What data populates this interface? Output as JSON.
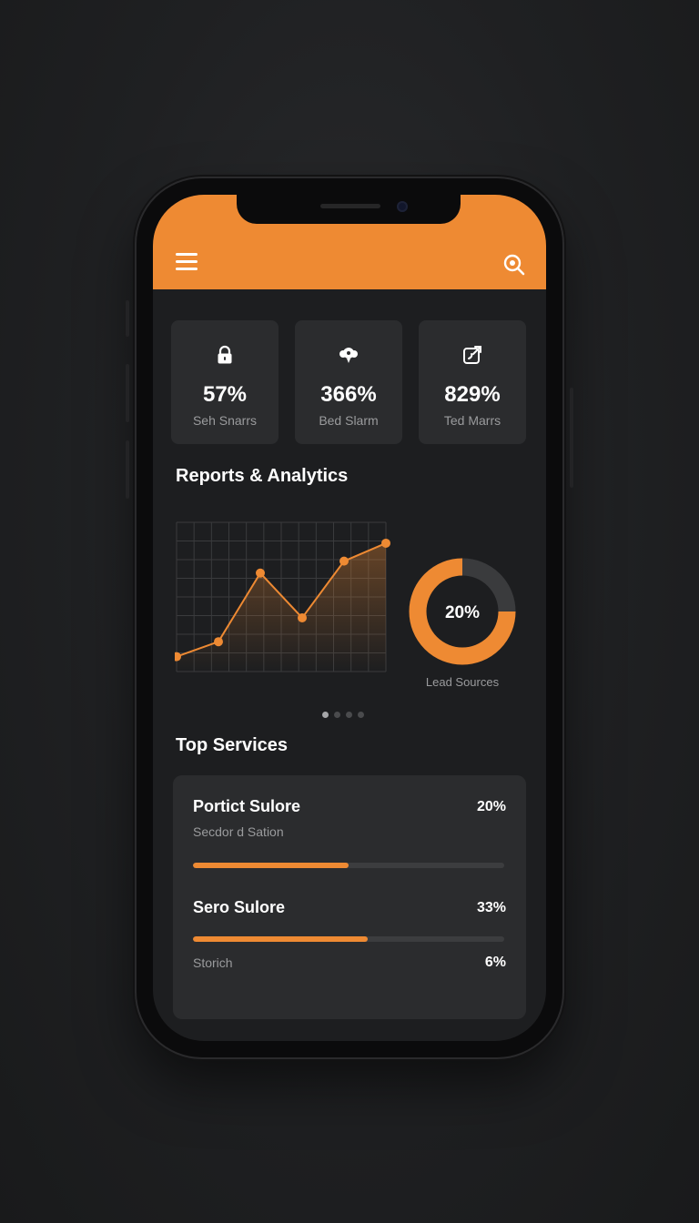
{
  "header": {
    "menu_icon": "menu-icon",
    "search_icon": "search-icon",
    "accent_color": "#ee8a33"
  },
  "stats": [
    {
      "icon": "lock-icon",
      "value": "57%",
      "label": "Seh Snarrs"
    },
    {
      "icon": "cloud-icon",
      "value": "366%",
      "label": "Bed Slarm"
    },
    {
      "icon": "edit-icon",
      "value": "829%",
      "label": "Ted Marrs"
    }
  ],
  "reports": {
    "title": "Reports & Analytics"
  },
  "chart_data": [
    {
      "type": "line",
      "title": "",
      "xlabel": "",
      "ylabel": "",
      "x": [
        1,
        2,
        3,
        4,
        5,
        6
      ],
      "series": [
        {
          "values": [
            10,
            20,
            66,
            36,
            74,
            86
          ]
        }
      ],
      "ylim": [
        0,
        100
      ],
      "grid": true
    },
    {
      "type": "pie",
      "donut": true,
      "center_label": "20%",
      "label": "Lead Sources",
      "slices": [
        {
          "value": 75,
          "color": "#ee8a33"
        },
        {
          "value": 25,
          "color": "#3a3b3d"
        }
      ]
    }
  ],
  "pagination": {
    "count": 4,
    "active": 0
  },
  "services": {
    "title": "Top Services",
    "items": [
      {
        "name": "Portict Sulore",
        "percent": "20%",
        "subtitle": "Secdor d Sation",
        "progress": 0.5
      },
      {
        "name": "Sero Sulore",
        "percent": "33%",
        "progress": 0.56
      }
    ],
    "footer": {
      "label": "Storich",
      "percent": "6%"
    }
  }
}
